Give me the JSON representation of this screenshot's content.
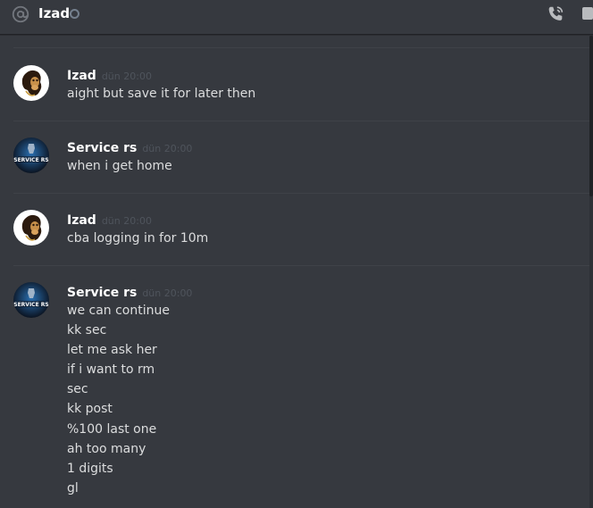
{
  "header": {
    "dm_name": "Izad",
    "icons": [
      "at-sign-icon",
      "status-offline-icon",
      "call-icon",
      "inbox-icon"
    ]
  },
  "messages": [
    {
      "author": "Izad",
      "timestamp": "dün 20:00",
      "avatar": "bape-ape-avatar",
      "lines": [
        "aight but save it for later then"
      ]
    },
    {
      "author": "Service rs",
      "timestamp": "dün 20:00",
      "avatar": "service-rs-avatar",
      "avatar_text": "SERVICE RS",
      "lines": [
        "when i get home"
      ]
    },
    {
      "author": "Izad",
      "timestamp": "dün 20:00",
      "avatar": "bape-ape-avatar",
      "lines": [
        "cba logging in for 10m"
      ]
    },
    {
      "author": "Service rs",
      "timestamp": "dün 20:00",
      "avatar": "service-rs-avatar",
      "avatar_text": "SERVICE RS",
      "lines": [
        "we can continue",
        "kk sec",
        "let me ask her",
        "if i want to rm",
        "sec",
        "kk post",
        "%100 last one",
        "ah too many",
        "1 digits",
        "gl"
      ]
    }
  ],
  "colors": {
    "background": "#36393f",
    "header_border": "#202225",
    "author": "#ffffff",
    "message_text": "#dcddde",
    "timestamp": "#4f545c",
    "divider": "#3f4248"
  }
}
